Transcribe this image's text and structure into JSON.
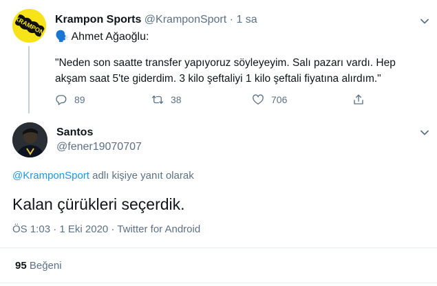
{
  "tweet1": {
    "display_name": "Krampon Sports",
    "handle": "@KramponSport",
    "separator": "·",
    "time": "1 sa",
    "line1": "🗣️ Ahmet Ağaoğlu:",
    "line2": "\"Neden son saatte transfer yapıyoruz söyleyeyim. Salı pazarı vardı. Hep",
    "line3": "akşam saat 5'te giderdim. 3 kilo şeftaliyi 1 kilo şeftali fiyatına alırdım.\"",
    "avatar_text": "KRAMPON",
    "replies": "89",
    "retweets": "38",
    "likes": "706"
  },
  "tweet2": {
    "display_name": "Santos",
    "handle": "@fener19070707",
    "reply_to_handle": "@KramponSport",
    "reply_to_suffix": " adlı kişiye yanıt olarak",
    "text": "Kalan çürükleri seçerdik.",
    "timestamp": "ÖS 1:03 · 1 Eki 2020 · Twitter for Android",
    "likes_count": "95",
    "likes_label": "Beğeni"
  },
  "icons": [
    "caret-down-icon",
    "reply-icon",
    "retweet-icon",
    "like-icon",
    "share-icon",
    "speaking-head-icon"
  ],
  "colors": {
    "link": "#1b95e0",
    "muted": "#5b7083",
    "avatar_yellow": "#f7e31a"
  }
}
